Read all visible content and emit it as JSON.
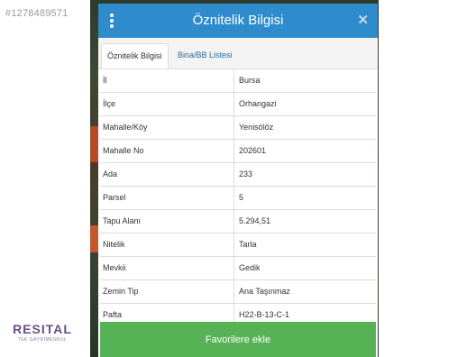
{
  "watermark": {
    "id_text": "#1278489571"
  },
  "logo": {
    "name": "RESITAL",
    "tagline": "TEK GAYRİMENKUL"
  },
  "modal": {
    "title": "Öznitelik Bilgisi",
    "close_icon": "close-icon",
    "menu_icon": "kebab-menu-icon",
    "header_color": "#2E8CCC",
    "tabs": [
      {
        "label": "Öznitelik Bilgisi",
        "active": true
      },
      {
        "label": "Bina/BB Listesi",
        "active": false
      }
    ],
    "rows": [
      {
        "label": "İl",
        "value": "Bursa"
      },
      {
        "label": "İlçe",
        "value": "Orhangazi"
      },
      {
        "label": "Mahalle/Köy",
        "value": "Yenisölöz"
      },
      {
        "label": "Mahalle No",
        "value": "202601"
      },
      {
        "label": "Ada",
        "value": "233"
      },
      {
        "label": "Parsel",
        "value": "5"
      },
      {
        "label": "Tapu Alanı",
        "value": "5.294,51"
      },
      {
        "label": "Nitelik",
        "value": "Tarla"
      },
      {
        "label": "Mevkii",
        "value": "Gedik"
      },
      {
        "label": "Zemin Tip",
        "value": "Ana Taşınmaz"
      },
      {
        "label": "Pafta",
        "value": "H22-B-13-C-1"
      }
    ],
    "favorite_button": {
      "label": "Favorilere ekle",
      "color": "#55B355"
    }
  }
}
